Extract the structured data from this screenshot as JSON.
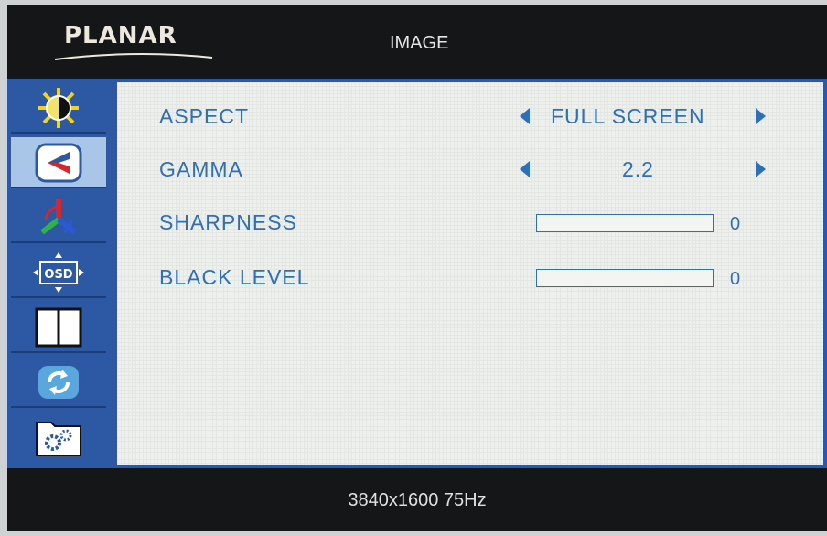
{
  "header": {
    "logo": "PLANAR",
    "title": "IMAGE"
  },
  "sidebar": {
    "items": [
      {
        "icon": "brightness-contrast-icon",
        "active": false
      },
      {
        "icon": "image-icon",
        "active": true
      },
      {
        "icon": "color-icon",
        "active": false
      },
      {
        "icon": "osd-icon",
        "label": "OSD",
        "active": false
      },
      {
        "icon": "pip-icon",
        "active": false
      },
      {
        "icon": "reset-icon",
        "active": false
      },
      {
        "icon": "setup-icon",
        "active": false
      }
    ]
  },
  "menu": {
    "aspect": {
      "label": "ASPECT",
      "value": "FULL SCREEN"
    },
    "gamma": {
      "label": "GAMMA",
      "value": "2.2"
    },
    "sharpness": {
      "label": "SHARPNESS",
      "value": "0",
      "level": 0
    },
    "black_level": {
      "label": "BLACK LEVEL",
      "value": "0",
      "level": 0
    }
  },
  "footer": {
    "resolution": "3840x1600  75Hz"
  },
  "colors": {
    "accent": "#2d6fb8",
    "frame": "#2d58a3",
    "active_tab": "#a9c6e8"
  }
}
